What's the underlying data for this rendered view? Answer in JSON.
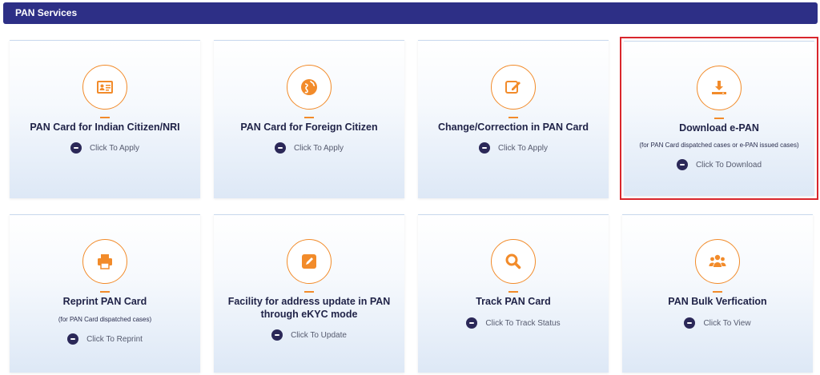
{
  "header": {
    "title": "PAN Services"
  },
  "colors": {
    "header_bg": "#2d2f86",
    "accent": "#f28b2a",
    "highlight": "#d9262c",
    "dark": "#2b2858"
  },
  "cards": [
    {
      "title": "PAN Card for Indian Citizen/NRI",
      "subtitle": "",
      "action": "Click To Apply",
      "icon": "id-card-icon"
    },
    {
      "title": "PAN Card for Foreign Citizen",
      "subtitle": "",
      "action": "Click To Apply",
      "icon": "globe-icon"
    },
    {
      "title": "Change/Correction in PAN Card",
      "subtitle": "",
      "action": "Click To Apply",
      "icon": "edit-icon"
    },
    {
      "title": "Download e-PAN",
      "subtitle": "(for PAN Card dispatched cases or e-PAN issued cases)",
      "action": "Click To Download",
      "icon": "download-icon"
    },
    {
      "title": "Reprint PAN Card",
      "subtitle": "(for PAN Card dispatched cases)",
      "action": "Click To Reprint",
      "icon": "printer-icon"
    },
    {
      "title": "Facility for address update in PAN through eKYC mode",
      "subtitle": "",
      "action": "Click To Update",
      "icon": "pencil-icon"
    },
    {
      "title": "Track PAN Card",
      "subtitle": "",
      "action": "Click To Track Status",
      "icon": "magnifier-icon"
    },
    {
      "title": "PAN Bulk Verfication",
      "subtitle": "",
      "action": "Click To View",
      "icon": "users-icon"
    }
  ]
}
